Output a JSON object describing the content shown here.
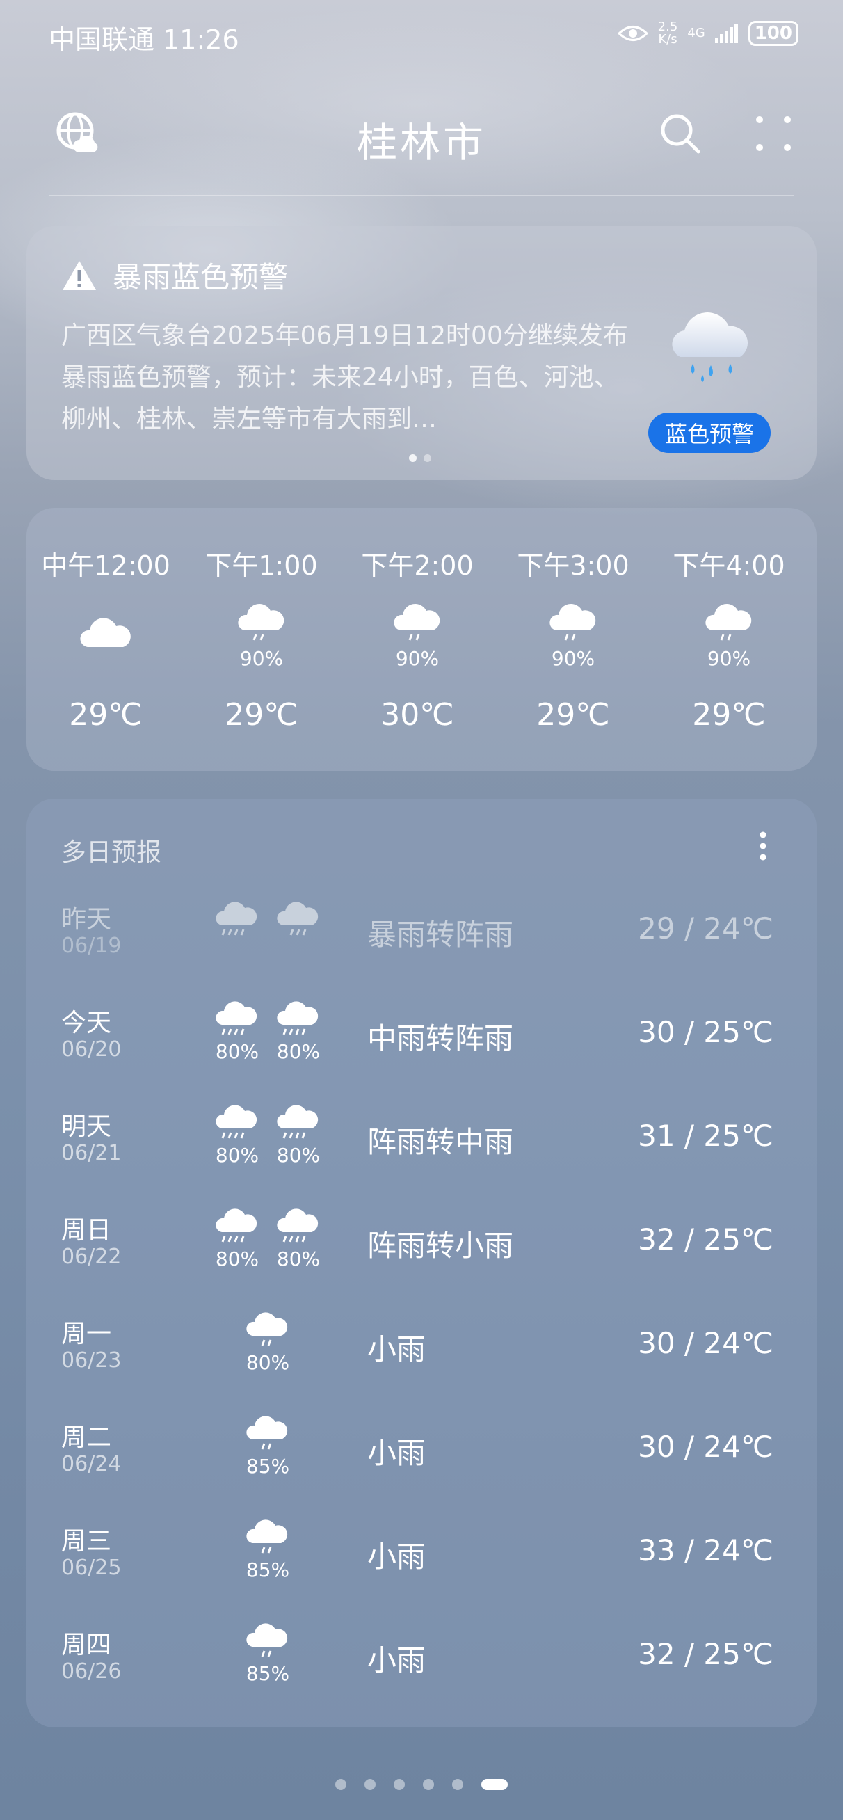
{
  "status_bar": {
    "carrier": "中国联通",
    "time": "11:26",
    "net_speed_value": "2.5",
    "net_speed_unit": "K/s",
    "signal": "4G",
    "battery": "100"
  },
  "header": {
    "city": "桂林市"
  },
  "alert": {
    "title": "暴雨蓝色预警",
    "body": "广西区气象台2025年06月19日12时00分继续发布暴雨蓝色预警，预计：未来24小时，百色、河池、柳州、桂林、崇左等市有大雨到…",
    "badge": "蓝色预警",
    "badge_color": "#1a73e8"
  },
  "hourly": [
    {
      "time": "中午12:00",
      "icon": "cloudy-icon",
      "pct": "",
      "temp": "29℃"
    },
    {
      "time": "下午1:00",
      "icon": "rain-icon",
      "pct": "90%",
      "temp": "29℃"
    },
    {
      "time": "下午2:00",
      "icon": "rain-icon",
      "pct": "90%",
      "temp": "30℃"
    },
    {
      "time": "下午3:00",
      "icon": "rain-icon",
      "pct": "90%",
      "temp": "29℃"
    },
    {
      "time": "下午4:00",
      "icon": "rain-icon",
      "pct": "90%",
      "temp": "29℃"
    }
  ],
  "daily": {
    "header": "多日预报",
    "rows": [
      {
        "day": "昨天",
        "date": "06/19",
        "icons": [
          "heavy-rain-icon",
          "rain-icon"
        ],
        "pcts": [
          "",
          ""
        ],
        "cond": "暴雨转阵雨",
        "temp": "29 / 24℃"
      },
      {
        "day": "今天",
        "date": "06/20",
        "icons": [
          "heavy-rain-icon",
          "heavy-rain-icon"
        ],
        "pcts": [
          "80%",
          "80%"
        ],
        "cond": "中雨转阵雨",
        "temp": "30 / 25℃"
      },
      {
        "day": "明天",
        "date": "06/21",
        "icons": [
          "heavy-rain-icon",
          "heavy-rain-icon"
        ],
        "pcts": [
          "80%",
          "80%"
        ],
        "cond": "阵雨转中雨",
        "temp": "31 / 25℃"
      },
      {
        "day": "周日",
        "date": "06/22",
        "icons": [
          "heavy-rain-icon",
          "heavy-rain-icon"
        ],
        "pcts": [
          "80%",
          "80%"
        ],
        "cond": "阵雨转小雨",
        "temp": "32 / 25℃"
      },
      {
        "day": "周一",
        "date": "06/23",
        "icons": [
          "light-rain-icon"
        ],
        "pcts": [
          "80%"
        ],
        "cond": "小雨",
        "temp": "30 / 24℃"
      },
      {
        "day": "周二",
        "date": "06/24",
        "icons": [
          "light-rain-icon"
        ],
        "pcts": [
          "85%"
        ],
        "cond": "小雨",
        "temp": "30 / 24℃"
      },
      {
        "day": "周三",
        "date": "06/25",
        "icons": [
          "light-rain-icon"
        ],
        "pcts": [
          "85%"
        ],
        "cond": "小雨",
        "temp": "33 / 24℃"
      },
      {
        "day": "周四",
        "date": "06/26",
        "icons": [
          "light-rain-icon"
        ],
        "pcts": [
          "85%"
        ],
        "cond": "小雨",
        "temp": "32 / 25℃"
      }
    ]
  },
  "pager": {
    "count": 6,
    "active": 5
  }
}
